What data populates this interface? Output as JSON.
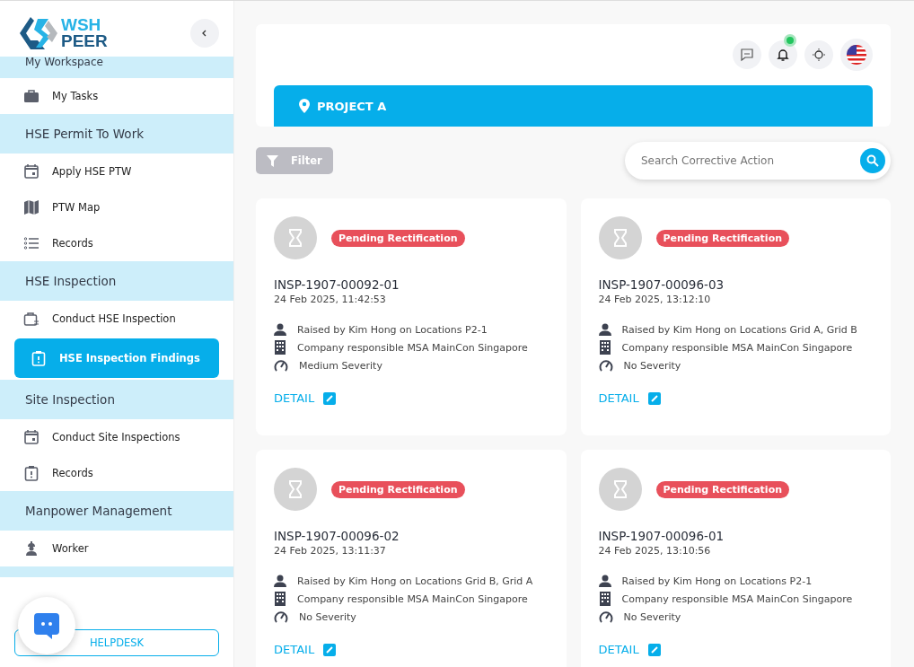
{
  "logo": {
    "line1": "WSH",
    "line2": "PEER"
  },
  "sidebar": {
    "sections": [
      {
        "title": "My Workspace",
        "items": [
          {
            "label": "My Tasks",
            "kind": "briefcase",
            "selected": false
          }
        ]
      },
      {
        "title": "HSE Permit To Work",
        "items": [
          {
            "label": "Apply HSE PTW",
            "kind": "calendar",
            "selected": false
          },
          {
            "label": "PTW Map",
            "kind": "map",
            "selected": false
          },
          {
            "label": "Records",
            "kind": "list",
            "selected": false
          }
        ]
      },
      {
        "title": "HSE Inspection",
        "items": [
          {
            "label": "Conduct HSE Inspection",
            "kind": "case",
            "selected": false
          },
          {
            "label": "HSE Inspection Findings",
            "kind": "clipboard",
            "selected": true
          }
        ]
      },
      {
        "title": "Site Inspection",
        "items": [
          {
            "label": "Conduct Site Inspections",
            "kind": "calendar",
            "selected": false
          },
          {
            "label": "Records",
            "kind": "clipboard",
            "selected": false
          }
        ]
      },
      {
        "title": "Manpower Management",
        "items": [
          {
            "label": "Worker",
            "kind": "worker",
            "selected": false
          }
        ]
      }
    ],
    "helpdesk": "HELPDESK"
  },
  "header": {
    "notification": true,
    "project": "PROJECT A"
  },
  "toolbar": {
    "filter": "Filter",
    "search_placeholder": "Search Corrective Action"
  },
  "cards": [
    {
      "status": "Pending Rectification",
      "id": "INSP-1907-00092-01",
      "date": "24 Feb 2025, 11:42:53",
      "raised": "Raised by Kim Hong on Locations P2-1",
      "company": "Company responsible MSA MainCon Singapore",
      "severity": "Medium Severity",
      "action": "DETAIL"
    },
    {
      "status": "Pending Rectification",
      "id": "INSP-1907-00096-03",
      "date": "24 Feb 2025, 13:12:10",
      "raised": "Raised by Kim Hong on Locations Grid A, Grid B",
      "company": "Company responsible MSA MainCon Singapore",
      "severity": "No Severity",
      "action": "DETAIL"
    },
    {
      "status": "Pending Rectification",
      "id": "INSP-1907-00096-02",
      "date": "24 Feb 2025, 13:11:37",
      "raised": "Raised by Kim Hong on Locations Grid B, Grid A",
      "company": "Company responsible MSA MainCon Singapore",
      "severity": "No Severity",
      "action": "DETAIL"
    },
    {
      "status": "Pending Rectification",
      "id": "INSP-1907-00096-01",
      "date": "24 Feb 2025, 13:10:56",
      "raised": "Raised by Kim Hong on Locations P2-1",
      "company": "Company responsible MSA MainCon Singapore",
      "severity": "No Severity",
      "action": "DETAIL"
    }
  ]
}
